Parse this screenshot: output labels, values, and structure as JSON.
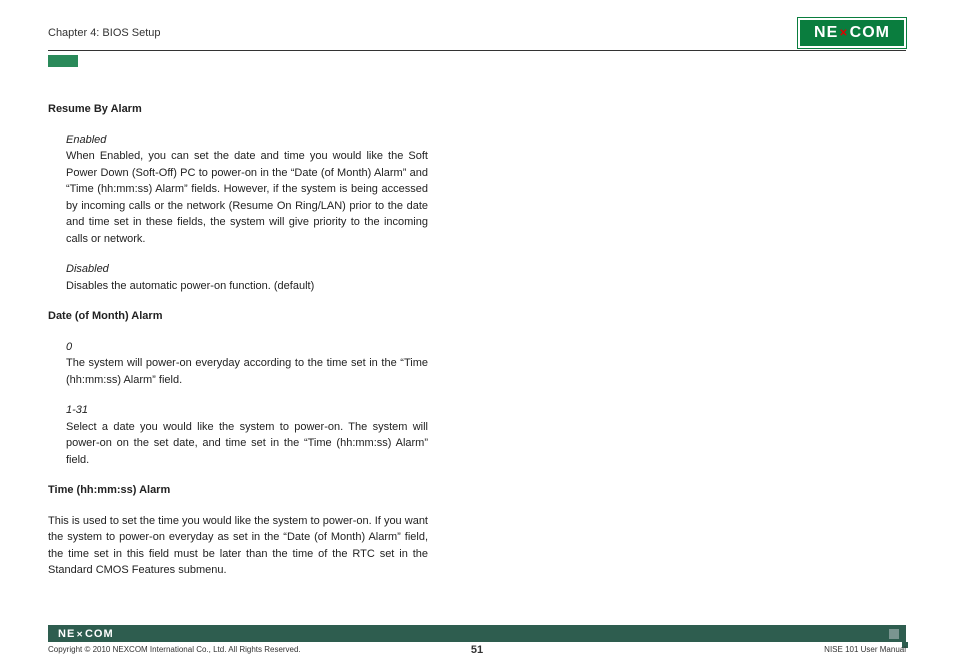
{
  "header": {
    "chapter": "Chapter 4: BIOS Setup",
    "logo": "NE COM"
  },
  "sections": {
    "resume_by_alarm": {
      "heading": "Resume By Alarm",
      "enabled_label": "Enabled",
      "enabled_text": "When Enabled, you can set the date and time you would like the Soft Power Down (Soft-Off) PC to power-on in the “Date (of Month) Alarm” and “Time (hh:mm:ss) Alarm” fields. However, if the system is being accessed by incoming calls or the network (Resume On Ring/LAN) prior to the date and time set in these fields, the system will give priority to the incoming calls or network.",
      "disabled_label": "Disabled",
      "disabled_text": "Disables the automatic power-on function. (default)"
    },
    "date_alarm": {
      "heading": "Date (of Month) Alarm",
      "zero_label": "0",
      "zero_text": "The system will power-on everyday according to the time set in the “Time (hh:mm:ss) Alarm” field.",
      "range_label": "1-31",
      "range_text": "Select a date you would like the system to power-on. The system will power-on on the set date, and time set in the “Time (hh:mm:ss) Alarm” field."
    },
    "time_alarm": {
      "heading": "Time (hh:mm:ss) Alarm",
      "text": "This is used to set the time you would like the system to power-on. If you want the system to power-on everyday as set in the “Date (of Month) Alarm” field, the time set in this field must be later than the time of the RTC set in the Standard CMOS Features submenu."
    }
  },
  "footer": {
    "logo": "NE COM",
    "copyright": "Copyright © 2010 NEXCOM International Co., Ltd. All Rights Reserved.",
    "page": "51",
    "manual": "NISE 101 User Manual"
  }
}
